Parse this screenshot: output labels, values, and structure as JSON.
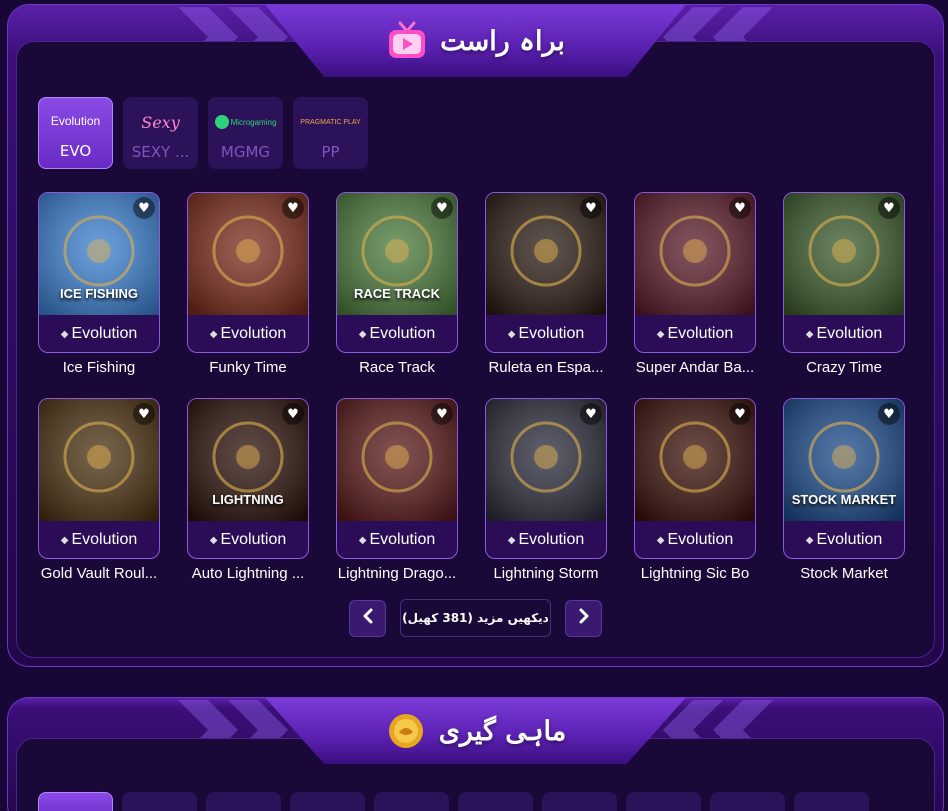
{
  "section_live": {
    "title": "براہ راست",
    "icon": "tv-icon",
    "providers": [
      {
        "logo": "Evolution",
        "label": "EVO",
        "active": true
      },
      {
        "logo": "Sexy",
        "label": "SEXY ...",
        "active": false
      },
      {
        "logo": "Microgaming",
        "label": "MGMG",
        "active": false
      },
      {
        "logo": "PRAGMATIC PLAY",
        "label": "PP",
        "active": false
      }
    ],
    "games": [
      {
        "name": "Ice Fishing",
        "brand": "Evolution",
        "thumb_text": "ICE FISHING",
        "bg": "#3a7fd0"
      },
      {
        "name": "Funky Time",
        "brand": "Evolution",
        "thumb_text": "",
        "bg": "#7a2a1a"
      },
      {
        "name": "Race Track",
        "brand": "Evolution",
        "thumb_text": "RACE TRACK",
        "bg": "#4a7a3a"
      },
      {
        "name": "Ruleta en Espa...",
        "brand": "Evolution",
        "thumb_text": "",
        "bg": "#2a1a12"
      },
      {
        "name": "Super Andar Ba...",
        "brand": "Evolution",
        "thumb_text": "",
        "bg": "#5a1a28"
      },
      {
        "name": "Crazy Time",
        "brand": "Evolution",
        "thumb_text": "",
        "bg": "#3a5a2a"
      },
      {
        "name": "Gold Vault Roul...",
        "brand": "Evolution",
        "thumb_text": "",
        "bg": "#4a3010"
      },
      {
        "name": "Auto Lightning ...",
        "brand": "Evolution",
        "thumb_text": "LIGHTNING",
        "bg": "#2a1008"
      },
      {
        "name": "Lightning Drago...",
        "brand": "Evolution",
        "thumb_text": "",
        "bg": "#5a1818"
      },
      {
        "name": "Lightning Storm",
        "brand": "Evolution",
        "thumb_text": "",
        "bg": "#2a2a3a"
      },
      {
        "name": "Lightning Sic Bo",
        "brand": "Evolution",
        "thumb_text": "",
        "bg": "#3a1008"
      },
      {
        "name": "Stock Market",
        "brand": "Evolution",
        "thumb_text": "STOCK MARKET",
        "bg": "#1a4a8a"
      }
    ],
    "pager": {
      "prev_icon": "chevron-left-icon",
      "next_icon": "chevron-right-icon",
      "more_label": "دیکھیں مزید (381 کھیل)"
    }
  },
  "section_fishing": {
    "title": "ماہی گیری",
    "icon": "coin-icon"
  },
  "colors": {
    "accent": "#8a4ae6",
    "bg": "#180736",
    "card_border": "#8c5ae0"
  }
}
